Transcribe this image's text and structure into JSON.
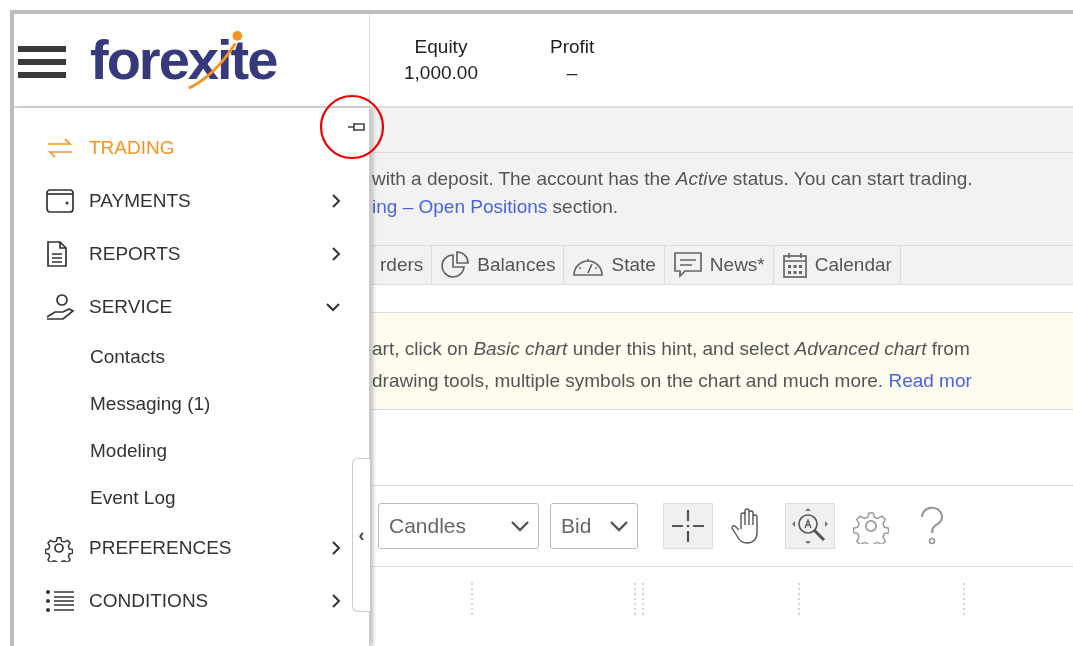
{
  "header": {
    "logo": "forexite",
    "stats": [
      {
        "label": "Equity",
        "value": "1,000.00"
      },
      {
        "label": "Profit",
        "value": "–"
      }
    ]
  },
  "sidebar": {
    "items": [
      {
        "label": "TRADING",
        "kind": "link",
        "selected": true
      },
      {
        "label": "PAYMENTS",
        "kind": "submenu",
        "selected": false,
        "expanded": false
      },
      {
        "label": "REPORTS",
        "kind": "submenu",
        "selected": false,
        "expanded": false
      },
      {
        "label": "SERVICE",
        "kind": "submenu",
        "selected": false,
        "expanded": true,
        "children": [
          {
            "label": "Contacts",
            "selected": false
          },
          {
            "label": "Messaging (1)",
            "selected": false
          },
          {
            "label": "Modeling",
            "selected": false
          },
          {
            "label": "Event Log",
            "selected": false
          }
        ]
      },
      {
        "label": "PREFERENCES",
        "kind": "submenu",
        "selected": false,
        "expanded": false
      },
      {
        "label": "CONDITIONS",
        "kind": "submenu",
        "selected": false,
        "expanded": false
      }
    ],
    "handle": "‹"
  },
  "notice": {
    "line_1": "with a deposit. The account has the *Active* status. You can start trading.",
    "link": "ing – Open Positions",
    "rest": "section."
  },
  "tabs": [
    {
      "label": "rders"
    },
    {
      "label": "Balances"
    },
    {
      "label": "State"
    },
    {
      "label": "News*"
    },
    {
      "label": "Calendar"
    }
  ],
  "hint": {
    "line_1": "art, click on *Basic chart* under this hint, and select *Advanced chart* from",
    "line_2": "drawing tools, multiple symbols on the chart and much more.",
    "link": "Read mor"
  },
  "toolbar": {
    "selects": [
      {
        "value": "Candles"
      },
      {
        "value": "Bid"
      }
    ],
    "tools": [
      {
        "pressed": true
      },
      {
        "pressed": false
      },
      {
        "pressed": true
      },
      {
        "pressed": false
      },
      {
        "pressed": false
      }
    ]
  }
}
